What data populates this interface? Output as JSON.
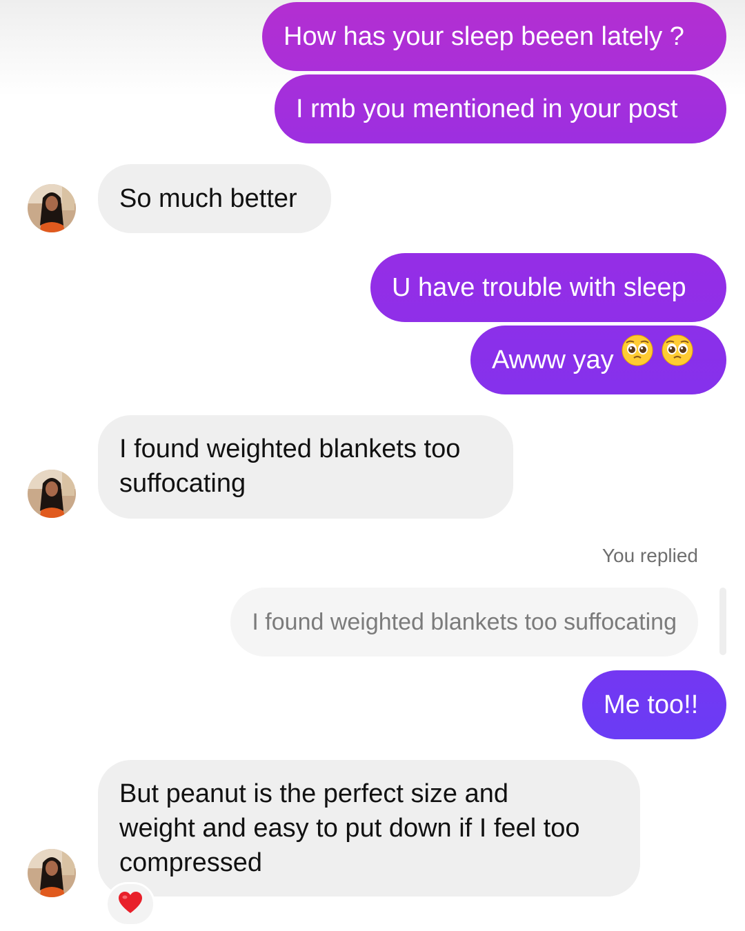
{
  "messages": {
    "m1": {
      "text": "How has your sleep beeen lately ?"
    },
    "m2": {
      "text": "I rmb you mentioned in your post"
    },
    "m3": {
      "text": "So much better"
    },
    "m4": {
      "text": "U have trouble with sleep"
    },
    "m5": {
      "text": "Awww yay",
      "emoji": [
        "pleading-face-icon",
        "pleading-face-icon"
      ]
    },
    "m6": {
      "line1": "I found weighted blankets too",
      "line2": "suffocating"
    },
    "reply": {
      "label": "You replied",
      "quoted": "I found weighted blankets too suffocating"
    },
    "m7": {
      "text": "Me too!!"
    },
    "m8": {
      "line1": "But peanut is the perfect size and",
      "line2": "weight and easy to put down if I feel too",
      "line3": "compressed",
      "reaction": "heart-icon"
    }
  },
  "colors": {
    "outgoing_gradient_top": "#b12ed3",
    "outgoing_gradient_mid": "#962ee8",
    "outgoing_gradient_bottom": "#6a3ef5",
    "incoming_bubble": "#efefef",
    "reaction_heart": "#e8202a"
  }
}
